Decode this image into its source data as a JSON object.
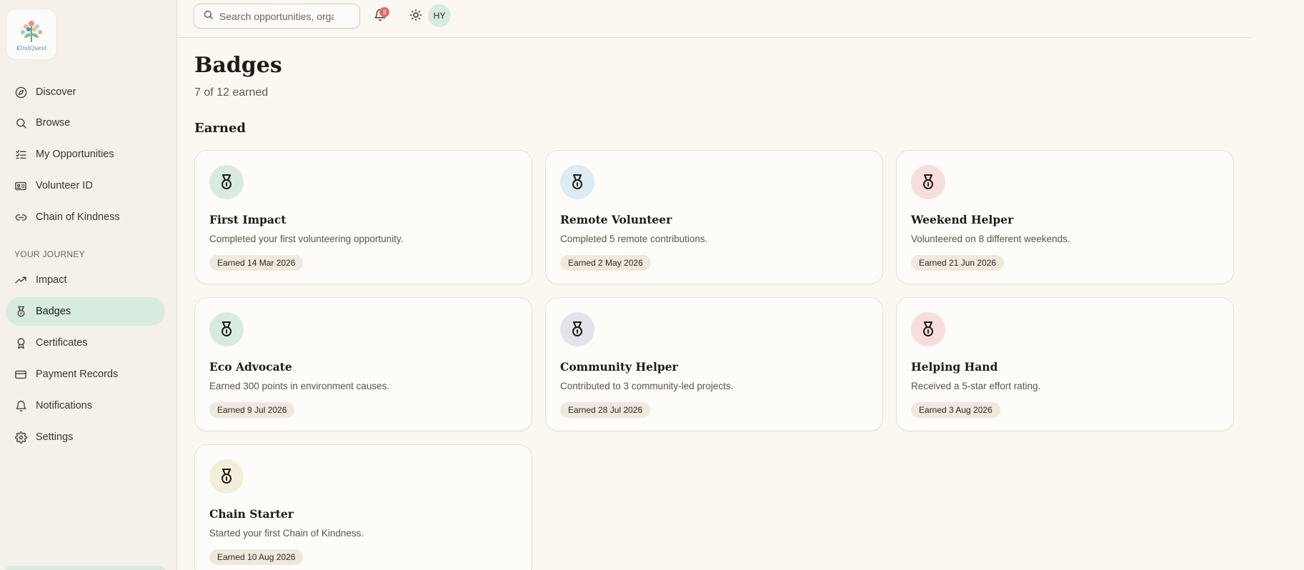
{
  "app": {
    "logo_text": "KindQuest"
  },
  "sidebar": {
    "items": [
      {
        "label": "Discover",
        "icon": "compass-icon"
      },
      {
        "label": "Browse",
        "icon": "search-icon"
      },
      {
        "label": "My Opportunities",
        "icon": "checklist-icon"
      },
      {
        "label": "Volunteer ID",
        "icon": "id-card-icon"
      },
      {
        "label": "Chain of Kindness",
        "icon": "link-icon"
      }
    ],
    "section_label": "YOUR JOURNEY",
    "journey_items": [
      {
        "label": "Impact",
        "icon": "trending-up-icon"
      },
      {
        "label": "Badges",
        "icon": "medal-icon",
        "active": true
      },
      {
        "label": "Certificates",
        "icon": "award-icon"
      },
      {
        "label": "Payment Records",
        "icon": "credit-card-icon"
      },
      {
        "label": "Notifications",
        "icon": "bell-icon"
      },
      {
        "label": "Settings",
        "icon": "gear-icon"
      }
    ]
  },
  "topbar": {
    "search_placeholder": "Search opportunities, organizations",
    "notification_count": "3",
    "avatar_initials": "HY"
  },
  "main": {
    "title": "Badges",
    "subtitle": "7 of 12 earned",
    "section_title": "Earned",
    "badges": [
      {
        "title": "First Impact",
        "description": "Completed your first volunteering opportunity.",
        "earned": "Earned 14 Mar 2026",
        "color": "#d7ecdf"
      },
      {
        "title": "Remote Volunteer",
        "description": "Completed 5 remote contributions.",
        "earned": "Earned 2 May 2026",
        "color": "#dcecf3"
      },
      {
        "title": "Weekend Helper",
        "description": "Volunteered on 8 different weekends.",
        "earned": "Earned 21 Jun 2026",
        "color": "#f6dedc"
      },
      {
        "title": "Eco Advocate",
        "description": "Earned 300 points in environment causes.",
        "earned": "Earned 9 Jul 2026",
        "color": "#d7ecdf"
      },
      {
        "title": "Community Helper",
        "description": "Contributed to 3 community-led projects.",
        "earned": "Earned 28 Jul 2026",
        "color": "#e6e2ea"
      },
      {
        "title": "Helping Hand",
        "description": "Received a 5-star effort rating.",
        "earned": "Earned 3 Aug 2026",
        "color": "#f6dedc"
      },
      {
        "title": "Chain Starter",
        "description": "Started your first Chain of Kindness.",
        "earned": "Earned 10 Aug 2026",
        "color": "#f2eed9"
      }
    ]
  }
}
